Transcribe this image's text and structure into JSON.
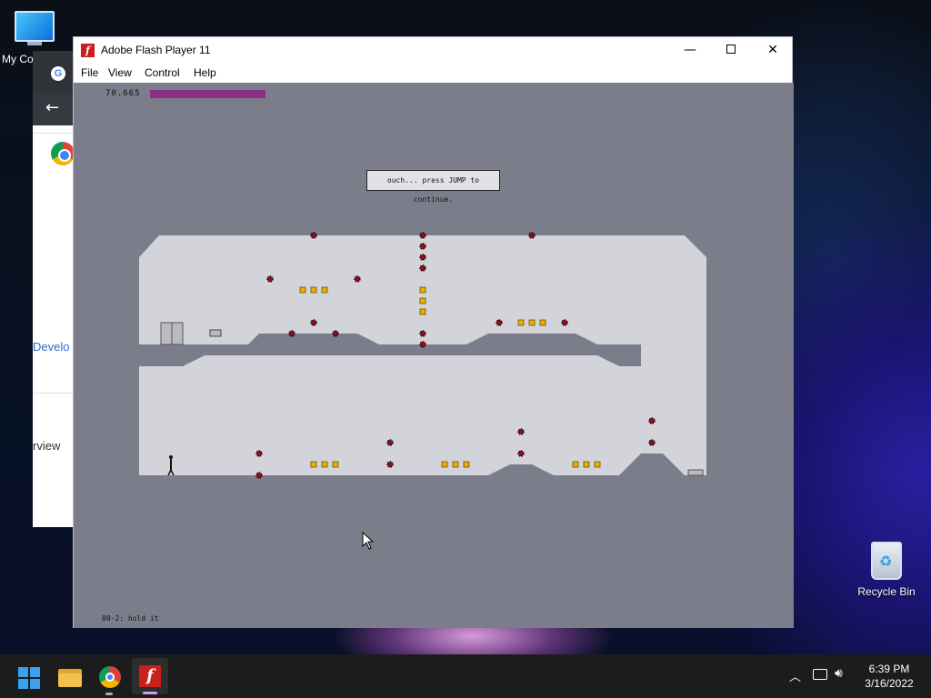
{
  "desktop": {
    "my_computer_label": "My Co",
    "recycle_bin_label": "Recycle Bin"
  },
  "chrome_window": {
    "text_1": "Develo",
    "text_2": "rview"
  },
  "window": {
    "title": "Adobe Flash Player 11",
    "minimize_glyph": "—",
    "close_glyph": "✕",
    "menu": [
      "File",
      "View",
      "Control",
      "Help"
    ]
  },
  "game": {
    "timer_value": "70.665",
    "time_remaining_fraction": 0.53,
    "message": "ouch... press JUMP to continue.",
    "level_name": "00-2: hold it",
    "colors": {
      "background": "#7b7d8b",
      "level_fill": "#d3d4da",
      "timebar": "#8c2e84",
      "mine": "#8b1020",
      "gold": "#e8b000"
    }
  },
  "taskbar": {
    "time": "6:39 PM",
    "date": "3/16/2022",
    "icons": [
      "windows-start-icon",
      "file-explorer-icon",
      "chrome-icon",
      "flash-player-icon"
    ],
    "tray_icons": [
      "chevron-up-icon",
      "network-icon",
      "volume-icon"
    ]
  }
}
